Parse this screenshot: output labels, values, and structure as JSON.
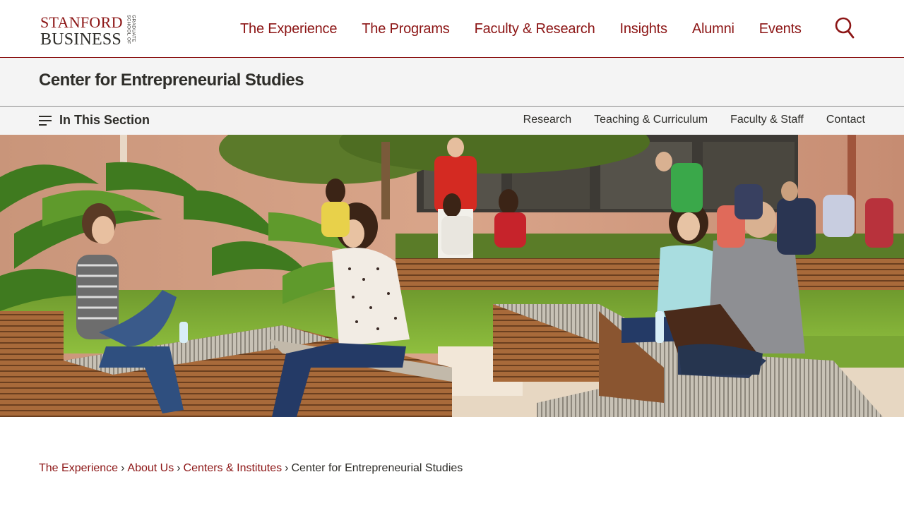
{
  "header": {
    "logo": {
      "line1": "STANFORD",
      "line2": "BUSINESS",
      "vertical": "GRADUATE SCHOOL OF"
    },
    "nav": [
      {
        "label": "The Experience"
      },
      {
        "label": "The Programs"
      },
      {
        "label": "Faculty & Research"
      },
      {
        "label": "Insights"
      },
      {
        "label": "Alumni"
      },
      {
        "label": "Events"
      }
    ],
    "search_icon": "search-icon"
  },
  "section": {
    "title": "Center for Entrepreneurial Studies"
  },
  "subnav": {
    "menu_icon": "hamburger-menu-icon",
    "toggle_label": "In This Section",
    "links": [
      {
        "label": "Research"
      },
      {
        "label": "Teaching & Curriculum"
      },
      {
        "label": "Faculty & Staff"
      },
      {
        "label": "Contact"
      }
    ]
  },
  "hero": {
    "image": "students-in-courtyard-photo"
  },
  "breadcrumb": {
    "items": [
      {
        "label": "The Experience"
      },
      {
        "label": "About Us"
      },
      {
        "label": "Centers & Institutes"
      }
    ],
    "separator": "›",
    "current": "Center for Entrepreneurial Studies"
  },
  "colors": {
    "brand": "#8c1515",
    "text": "#2e2d29",
    "band": "#f4f4f4"
  }
}
